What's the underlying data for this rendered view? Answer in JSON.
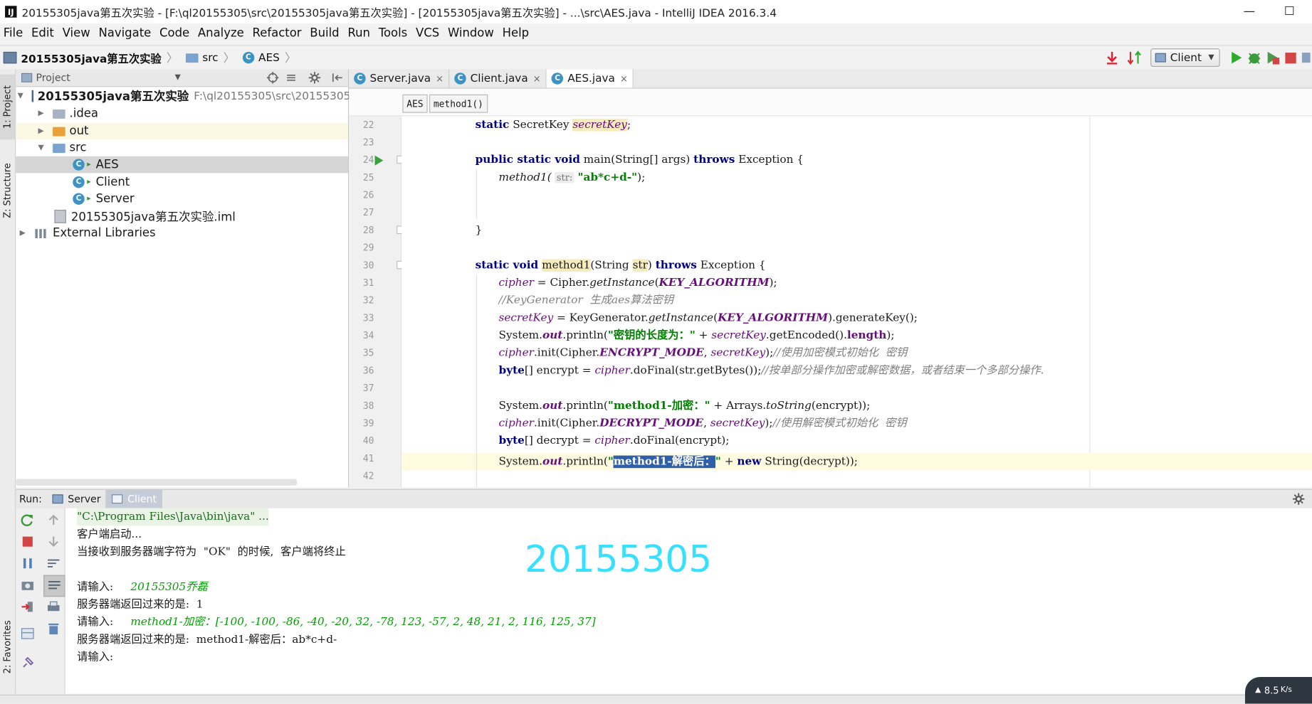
{
  "window": {
    "title": "20155305java第五次实验 - [F:\\ql20155305\\src\\20155305java第五次实验] - [20155305java第五次实验] - ...\\src\\AES.java - IntelliJ IDEA 2016.3.4",
    "app_icon": "IJ",
    "minimize_glyph": "—",
    "maximize_glyph": "☐"
  },
  "menu": [
    "File",
    "Edit",
    "View",
    "Navigate",
    "Code",
    "Analyze",
    "Refactor",
    "Build",
    "Run",
    "Tools",
    "VCS",
    "Window",
    "Help"
  ],
  "nav": {
    "crumbs": [
      "20155305java第五次实验",
      "src",
      "AES"
    ],
    "run_config": "Client",
    "class_glyph": "C"
  },
  "project_panel": {
    "title": "Project",
    "tree": [
      {
        "label": "20155305java第五次实验",
        "path": "F:\\ql20155305\\src\\20155305jav",
        "arrow": "▼",
        "icon": "module-icon"
      },
      {
        "label": ".idea",
        "arrow": "▶",
        "icon": "folder-icon"
      },
      {
        "label": "out",
        "arrow": "▶",
        "icon": "folder-orange-icon"
      },
      {
        "label": "src",
        "arrow": "▼",
        "icon": "folder-blue-icon"
      },
      {
        "label": "AES",
        "icon": "class-icon"
      },
      {
        "label": "Client",
        "icon": "class-icon"
      },
      {
        "label": "Server",
        "icon": "class-icon"
      },
      {
        "label": "20155305java第五次实验.iml",
        "icon": "iml-file-icon"
      },
      {
        "label": "External Libraries",
        "arrow": "▶",
        "icon": "library-icon"
      }
    ]
  },
  "side_tabs": {
    "project": "1: Project",
    "structure": "Z: Structure",
    "favorites": "2: Favorites"
  },
  "editor": {
    "tabs": [
      {
        "label": "Server.java",
        "close": "×"
      },
      {
        "label": "Client.java",
        "close": "×"
      },
      {
        "label": "AES.java",
        "close": "×",
        "active": true
      }
    ],
    "breadcrumbs": [
      "AES",
      "method1()"
    ],
    "line_numbers": [
      "22",
      "23",
      "24",
      "25",
      "26",
      "27",
      "28",
      "29",
      "30",
      "31",
      "32",
      "33",
      "34",
      "35",
      "36",
      "37",
      "38",
      "39",
      "40",
      "41",
      "42"
    ]
  },
  "code": {
    "l22": {
      "kw": "static",
      "type": "SecretKey",
      "var": "secretKey",
      "end": ";"
    },
    "l24": {
      "kw": "public static void",
      "name": "main(String[] args)",
      "kw2": "throws",
      "rest": "Exception {"
    },
    "l25": {
      "call": "method1(",
      "hint": "str:",
      "arg": "\"ab*c+d-\"",
      "end": ");"
    },
    "l28": {
      "brace": "}"
    },
    "l30": {
      "kw": "static void",
      "name": "method1",
      "p1": "(String",
      "param": "str",
      "p2": ")",
      "kw2": "throws",
      "rest": "Exception {"
    },
    "l31": {
      "var": "cipher",
      "eq": " = Cipher.",
      "call": "getInstance",
      "p": "(",
      "const": "KEY_ALGORITHM",
      "end": ");"
    },
    "l32": {
      "comment": "//KeyGenerator  生成aes算法密钥"
    },
    "l33": {
      "var": "secretKey",
      "eq": " = KeyGenerator.",
      "call": "getInstance",
      "p": "(",
      "const": "KEY_ALGORITHM",
      "end": ").generateKey();"
    },
    "l34": {
      "pre": "System.",
      "out": "out",
      "p": ".println(",
      "str": "\"密钥的长度为：\"",
      "plus": " + ",
      "var": "secretKey",
      "mid": ".getEncoded().",
      "len": "length",
      "end": ");"
    },
    "l35": {
      "var": "cipher",
      "p": ".init(Cipher.",
      "const": "ENCRYPT_MODE",
      "sep": ", ",
      "var2": "secretKey",
      "end": ");",
      "comment": "//使用加密模式初始化  密钥"
    },
    "l36": {
      "kw": "byte",
      "p": "[] encrypt = ",
      "var": "cipher",
      "rest": ".doFinal(str.getBytes());",
      "comment": "//按单部分操作加密或解密数据，或者结束一个多部分操作."
    },
    "l38": {
      "pre": "System.",
      "out": "out",
      "p": ".println(",
      "str": "\"method1-加密：\"",
      "plus": " + Arrays.",
      "call": "toString",
      "end": "(encrypt));"
    },
    "l39": {
      "var": "cipher",
      "p": ".init(Cipher.",
      "const": "DECRYPT_MODE",
      "sep": ", ",
      "var2": "secretKey",
      "end": ");",
      "comment": "//使用解密模式初始化  密钥"
    },
    "l40": {
      "kw": "byte",
      "p": "[] decrypt = ",
      "var": "cipher",
      "rest": ".doFinal(encrypt);"
    },
    "l41": {
      "pre": "System.",
      "out": "out",
      "p": ".println(",
      "q1": "\"",
      "str": "method1-解密后：",
      "q2": "\"",
      "plus": " + ",
      "kw": "new",
      "end": " String(decrypt));"
    }
  },
  "run_panel": {
    "label": "Run:",
    "tabs": [
      {
        "label": "Server"
      },
      {
        "label": "Client",
        "active": true
      }
    ],
    "console": {
      "cmd": "\"C:\\Program Files\\Java\\bin\\java\" ...",
      "l1": "客户端启动...",
      "l2": "当接收到服务器端字符为  \"OK\"  的时候,  客户端将终止",
      "prompt": "请输入:",
      "input1": "20155305乔磊",
      "resp_label": "服务器端返回过来的是:",
      "resp1": "1",
      "input2": "method1-加密：[-100, -100, -86, -40, -20, 32, -78, 123, -57, 2, 48, 21, 2, 116, 125, 37]",
      "resp2": "method1-解密后：ab*c+d-"
    },
    "watermark": "20155305"
  },
  "net_badge": {
    "speed": "8.5",
    "unit": "K/s"
  },
  "colors": {
    "keyword": "#000080",
    "field": "#660e7a",
    "string": "#008000",
    "comment": "#808080",
    "watermark": "#38e0ff"
  }
}
